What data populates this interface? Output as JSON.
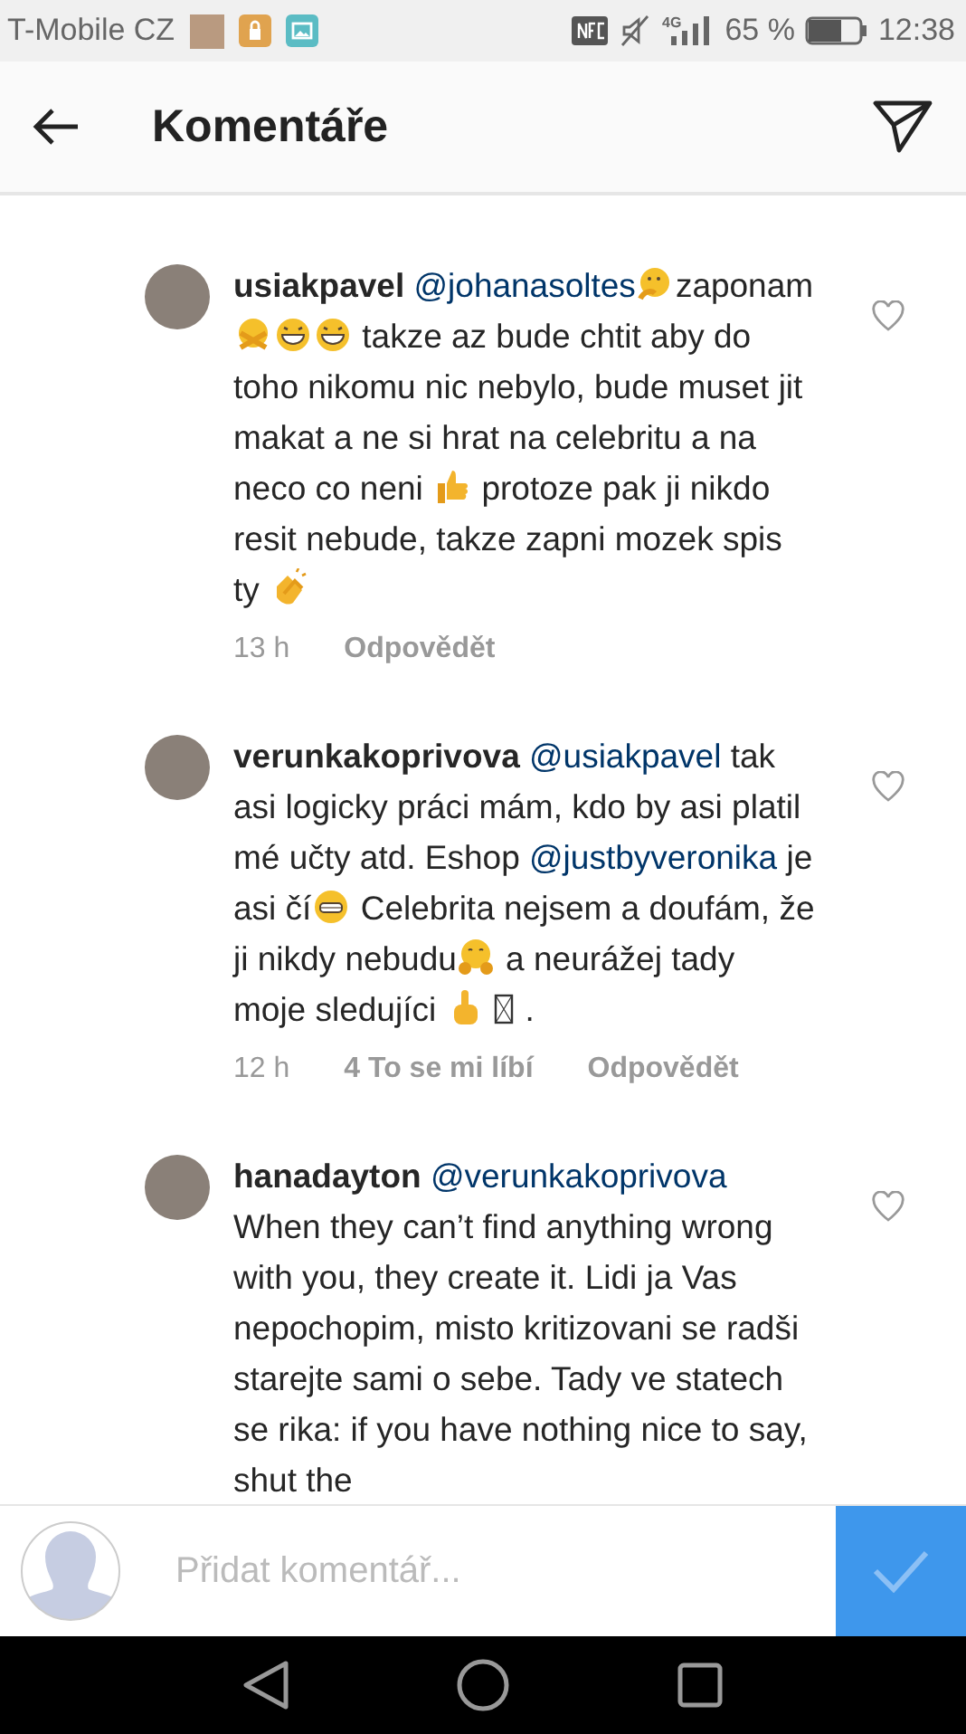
{
  "status_bar": {
    "carrier": "T-Mobile CZ",
    "network": "4G",
    "battery_text": "65 %",
    "time": "12:38"
  },
  "header": {
    "title": "Komentáře"
  },
  "comments": [
    {
      "user": "usiakpavel",
      "liked": false,
      "time": "13 h",
      "reply": "Odpovědět",
      "body": [
        {
          "kind": "mention",
          "text": "@johanasoltes"
        },
        {
          "kind": "thinking"
        },
        {
          "kind": "text",
          "text": "zaponam "
        },
        {
          "kind": "hiding"
        },
        {
          "kind": "laughing"
        },
        {
          "kind": "laughing"
        },
        {
          "kind": "text",
          "text": " takze az bude chtit aby do toho nikomu nic nebylo, bude muset jit makat a ne si hrat na celebritu a na neco co neni "
        },
        {
          "kind": "thumbsup"
        },
        {
          "kind": "text",
          "text": " protoze pak ji nikdo resit nebude, takze zapni mozek spis ty "
        },
        {
          "kind": "clapping"
        }
      ]
    },
    {
      "user": "verunkakoprivova",
      "liked": false,
      "time": "12 h",
      "likes": "4 To se mi líbí",
      "reply": "Odpovědět",
      "body": [
        {
          "kind": "mention",
          "text": "@usiakpavel"
        },
        {
          "kind": "text",
          "text": " tak asi logicky práci mám, kdo by asi platil mé učty atd. Eshop "
        },
        {
          "kind": "mention",
          "text": "@justbyveronika"
        },
        {
          "kind": "text",
          "text": " je asi čí"
        },
        {
          "kind": "grinning"
        },
        {
          "kind": "text",
          "text": " Celebrita nejsem a doufám, že ji nikdy nebudu"
        },
        {
          "kind": "hugging"
        },
        {
          "kind": "text",
          "text": " a neurážej tady moje sledujíci "
        },
        {
          "kind": "pointing"
        },
        {
          "kind": "tofu"
        },
        {
          "kind": "text",
          "text": "."
        }
      ]
    },
    {
      "user": "hanadayton",
      "liked": false,
      "body": [
        {
          "kind": "mention",
          "text": "@verunkakoprivova"
        },
        {
          "kind": "text",
          "text": " When they can’t find anything wrong with you, they create it. Lidi ja Vas nepochopim, misto kritizovani se radši starejte sami o sebe. Tady ve statech se rika: if you have nothing nice to say, shut the"
        }
      ]
    }
  ],
  "composer": {
    "placeholder": "Přidat komentář..."
  }
}
